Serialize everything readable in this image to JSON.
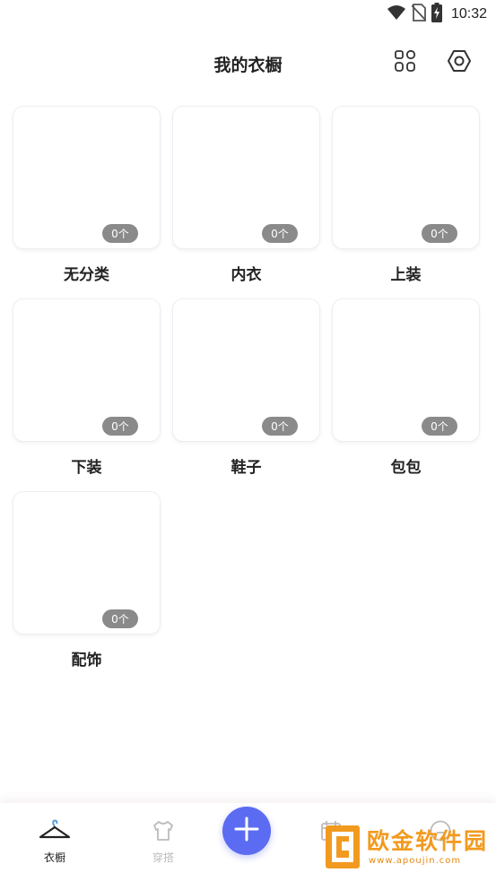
{
  "status_bar": {
    "time": "10:32",
    "icons": [
      "wifi-icon",
      "no-sim-icon",
      "battery-charging-icon"
    ]
  },
  "header": {
    "title": "我的衣橱",
    "layout_icon": "grid-layout-icon",
    "settings_icon": "settings-hex-icon"
  },
  "categories": [
    {
      "label": "无分类",
      "count": "0个"
    },
    {
      "label": "内衣",
      "count": "0个"
    },
    {
      "label": "上装",
      "count": "0个"
    },
    {
      "label": "下装",
      "count": "0个"
    },
    {
      "label": "鞋子",
      "count": "0个"
    },
    {
      "label": "包包",
      "count": "0个"
    },
    {
      "label": "配饰",
      "count": "0个"
    }
  ],
  "bottom_nav": {
    "items": [
      {
        "label": "衣橱",
        "icon": "hanger-icon",
        "active": true
      },
      {
        "label": "穿搭",
        "icon": "tshirt-icon",
        "active": false
      },
      {
        "label": "",
        "icon": "calendar-icon",
        "active": false
      },
      {
        "label": "",
        "icon": "face-icon",
        "active": false
      }
    ],
    "fab_icon": "plus-icon"
  },
  "watermark": {
    "title": "欧金软件园",
    "url": "www.apoujin.com"
  },
  "colors": {
    "accent": "#5b6cf2",
    "badge": "#8a8a8a",
    "watermark": "#f29a1f"
  }
}
